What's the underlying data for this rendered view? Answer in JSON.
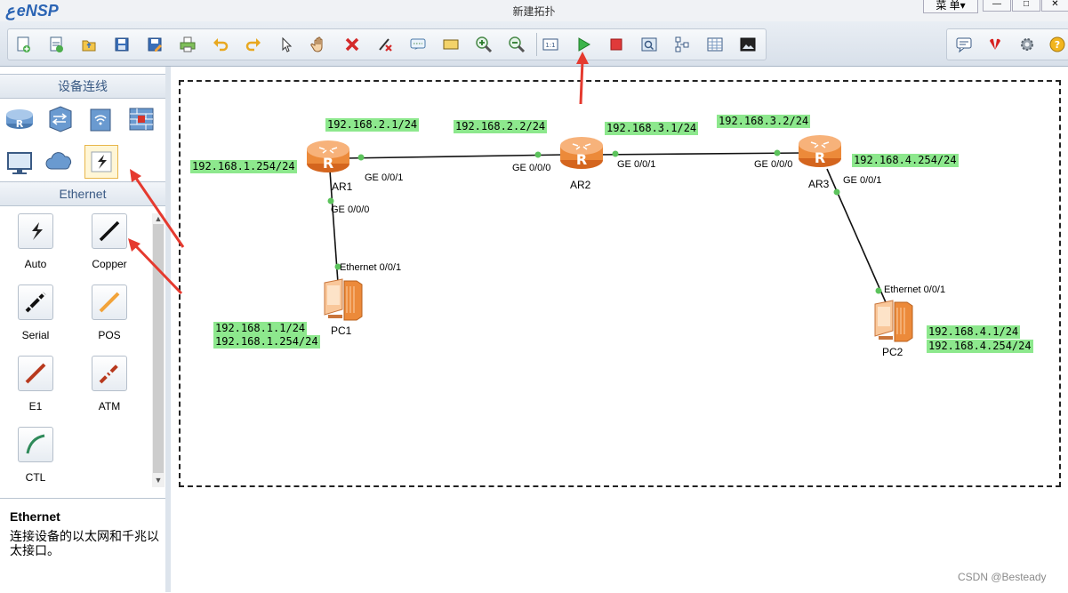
{
  "app": {
    "logo_text": "eNSP",
    "window_title": "新建拓扑",
    "menu_label": "菜 单▾"
  },
  "toolbar": {
    "icons": [
      "new-topology-icon",
      "new-lab-icon",
      "open-icon",
      "save-icon",
      "save-as-icon",
      "print-icon",
      "undo-icon",
      "redo-icon",
      "select-icon",
      "pan-hand-icon",
      "delete-icon",
      "delete-link-icon",
      "text-note-icon",
      "rectangle-icon",
      "zoom-in-icon",
      "zoom-out-icon",
      "fit-view-icon",
      "start-device-icon",
      "stop-device-icon",
      "capture-icon",
      "topology-view-icon",
      "grid-icon",
      "screenshot-icon"
    ],
    "right_icons": [
      "feedback-icon",
      "huawei-logo-icon",
      "settings-gear-icon",
      "help-icon"
    ]
  },
  "left_panel": {
    "device_heading": "设备连线",
    "categories": [
      "router-category-icon",
      "switch-category-icon",
      "wireless-category-icon",
      "firewall-category-icon",
      "pc-category-icon",
      "cloud-category-icon",
      "cable-category-icon"
    ],
    "selected_category": "cable-category-icon",
    "cable_heading": "Ethernet",
    "cables": [
      {
        "label": "Auto",
        "color": "#222222",
        "kind": "auto"
      },
      {
        "label": "Copper",
        "color": "#111111",
        "kind": "line"
      },
      {
        "label": "Serial",
        "color": "#111111",
        "kind": "dotted"
      },
      {
        "label": "POS",
        "color": "#f2a33a",
        "kind": "line"
      },
      {
        "label": "E1",
        "color": "#b8391e",
        "kind": "line"
      },
      {
        "label": "ATM",
        "color": "#b8391e",
        "kind": "dotted"
      },
      {
        "label": "CTL",
        "color": "#2f8a5a",
        "kind": "curve"
      }
    ],
    "description": {
      "title": "Ethernet",
      "text": "连接设备的以太网和千兆以太接口。"
    }
  },
  "topology": {
    "devices": [
      {
        "id": "AR1",
        "label": "AR1",
        "type": "router"
      },
      {
        "id": "AR2",
        "label": "AR2",
        "type": "router"
      },
      {
        "id": "AR3",
        "label": "AR3",
        "type": "router"
      },
      {
        "id": "PC1",
        "label": "PC1",
        "type": "pc"
      },
      {
        "id": "PC2",
        "label": "PC2",
        "type": "pc"
      }
    ],
    "ports": {
      "ar1_ge001": "GE 0/0/1",
      "ar1_ge000": "GE 0/0/0",
      "ar2_ge000": "GE 0/0/0",
      "ar2_ge001": "GE 0/0/1",
      "ar3_ge000": "GE 0/0/0",
      "ar3_ge001": "GE 0/0/1",
      "pc1_eth": "Ethernet 0/0/1",
      "pc2_eth": "Ethernet 0/0/1"
    },
    "ip_labels": {
      "ar1_g1": "192.168.2.1/24",
      "ar1_g0": "192.168.1.254/24",
      "ar2_g0": "192.168.2.2/24",
      "ar2_g1": "192.168.3.1/24",
      "ar3_g0": "192.168.3.2/24",
      "ar3_g1": "192.168.4.254/24",
      "pc1_ip": "192.168.1.1/24",
      "pc1_gw": "192.168.1.254/24",
      "pc2_ip": "192.168.4.1/24",
      "pc2_gw": "192.168.4.254/24"
    },
    "link_color": "#111111",
    "port_dot_color": "#5cc35c",
    "ip_label_bg": "#8de88d",
    "annotation_arrow_color": "#e53a2f"
  },
  "watermark": "CSDN @Besteady"
}
